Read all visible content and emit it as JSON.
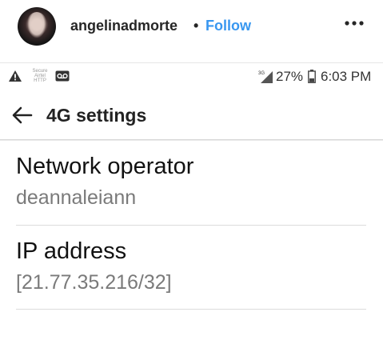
{
  "post_header": {
    "username": "angelinadmorte",
    "separator": "•",
    "follow_label": "Follow",
    "more_label": "•••"
  },
  "status_bar": {
    "tiny_label": "Secure Airtel HTTP",
    "network_type": "3G",
    "battery_percent": "27%",
    "time": "6:03 PM"
  },
  "app_bar": {
    "title": "4G settings"
  },
  "settings_items": [
    {
      "title": "Network operator",
      "value": "deannaleiann"
    },
    {
      "title": "IP address",
      "value": "[21.77.35.216/32]"
    }
  ],
  "colors": {
    "follow": "#3897f0",
    "text": "#111111",
    "subtext": "#7a7a7a"
  }
}
